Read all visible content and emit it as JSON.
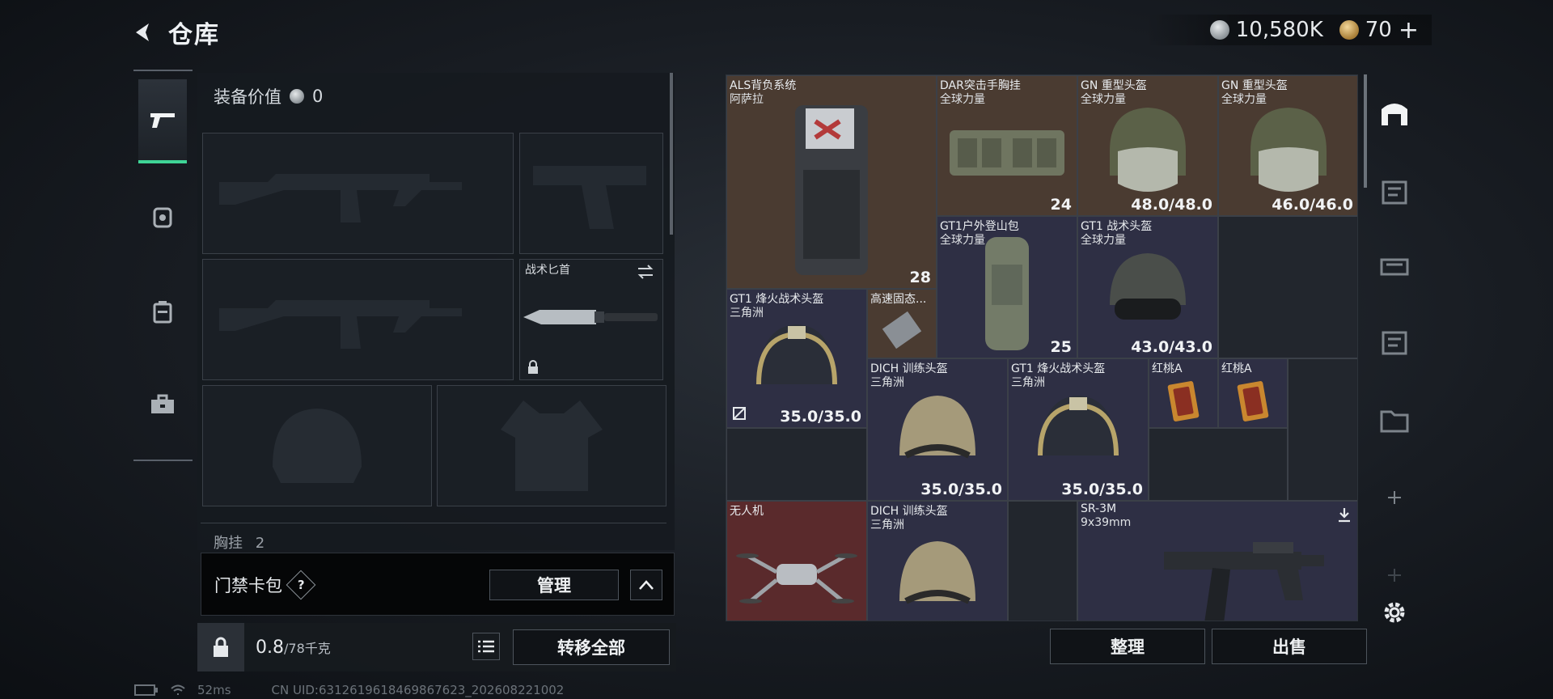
{
  "header": {
    "title": "仓库"
  },
  "currency": {
    "silver": "10,580K",
    "gold": "70",
    "gold_plus": "+"
  },
  "left_tabs": [
    "gun-icon",
    "helmet-icon",
    "backpack-icon",
    "toolbox-icon"
  ],
  "equipment": {
    "value_label": "装备价值",
    "value": "0",
    "knife_label": "战术匕首",
    "chest_label": "胸挂",
    "chest_count": "2"
  },
  "card_pack": {
    "label": "门禁卡包",
    "help": "?",
    "manage": "管理"
  },
  "weight": {
    "current": "0.8",
    "max": "/78千克",
    "transfer_all": "转移全部"
  },
  "status": {
    "ping": "52ms",
    "uid": "CN UID:6312619618469867623_202608221002"
  },
  "grid_items": [
    {
      "name": "ALS背负系统",
      "sub": "阿萨拉",
      "value": "28"
    },
    {
      "name": "DAR突击手胸挂",
      "sub": "全球力量",
      "value": "24"
    },
    {
      "name": "GN 重型头盔",
      "sub": "全球力量",
      "value": "48.0/48.0"
    },
    {
      "name": "GN 重型头盔",
      "sub": "全球力量",
      "value": "46.0/46.0"
    },
    {
      "name": "GT1户外登山包",
      "sub": "全球力量",
      "value": "25"
    },
    {
      "name": "GT1 战术头盔",
      "sub": "全球力量",
      "value": "43.0/43.0"
    },
    {
      "name": "GT1 烽火战术头盔",
      "sub": "三角洲",
      "value": "35.0/35.0"
    },
    {
      "name": "高速固态...",
      "sub": "",
      "value": ""
    },
    {
      "name": "DICH 训练头盔",
      "sub": "三角洲",
      "value": "35.0/35.0"
    },
    {
      "name": "GT1 烽火战术头盔",
      "sub": "三角洲",
      "value": "35.0/35.0"
    },
    {
      "name": "红桃A",
      "sub": "",
      "value": ""
    },
    {
      "name": "红桃A",
      "sub": "",
      "value": ""
    },
    {
      "name": "无人机",
      "sub": "",
      "value": ""
    },
    {
      "name": "DICH 训练头盔",
      "sub": "三角洲",
      "value": ""
    },
    {
      "name": "SR-3M",
      "sub": "9x39mm",
      "value": ""
    }
  ],
  "actions": {
    "sort": "整理",
    "sell": "出售"
  },
  "colors": {
    "accent_green": "#3fd496",
    "tier_orange": "#4a3b31",
    "tier_purple": "#2e2f44",
    "tier_red": "#5a2a2c"
  }
}
